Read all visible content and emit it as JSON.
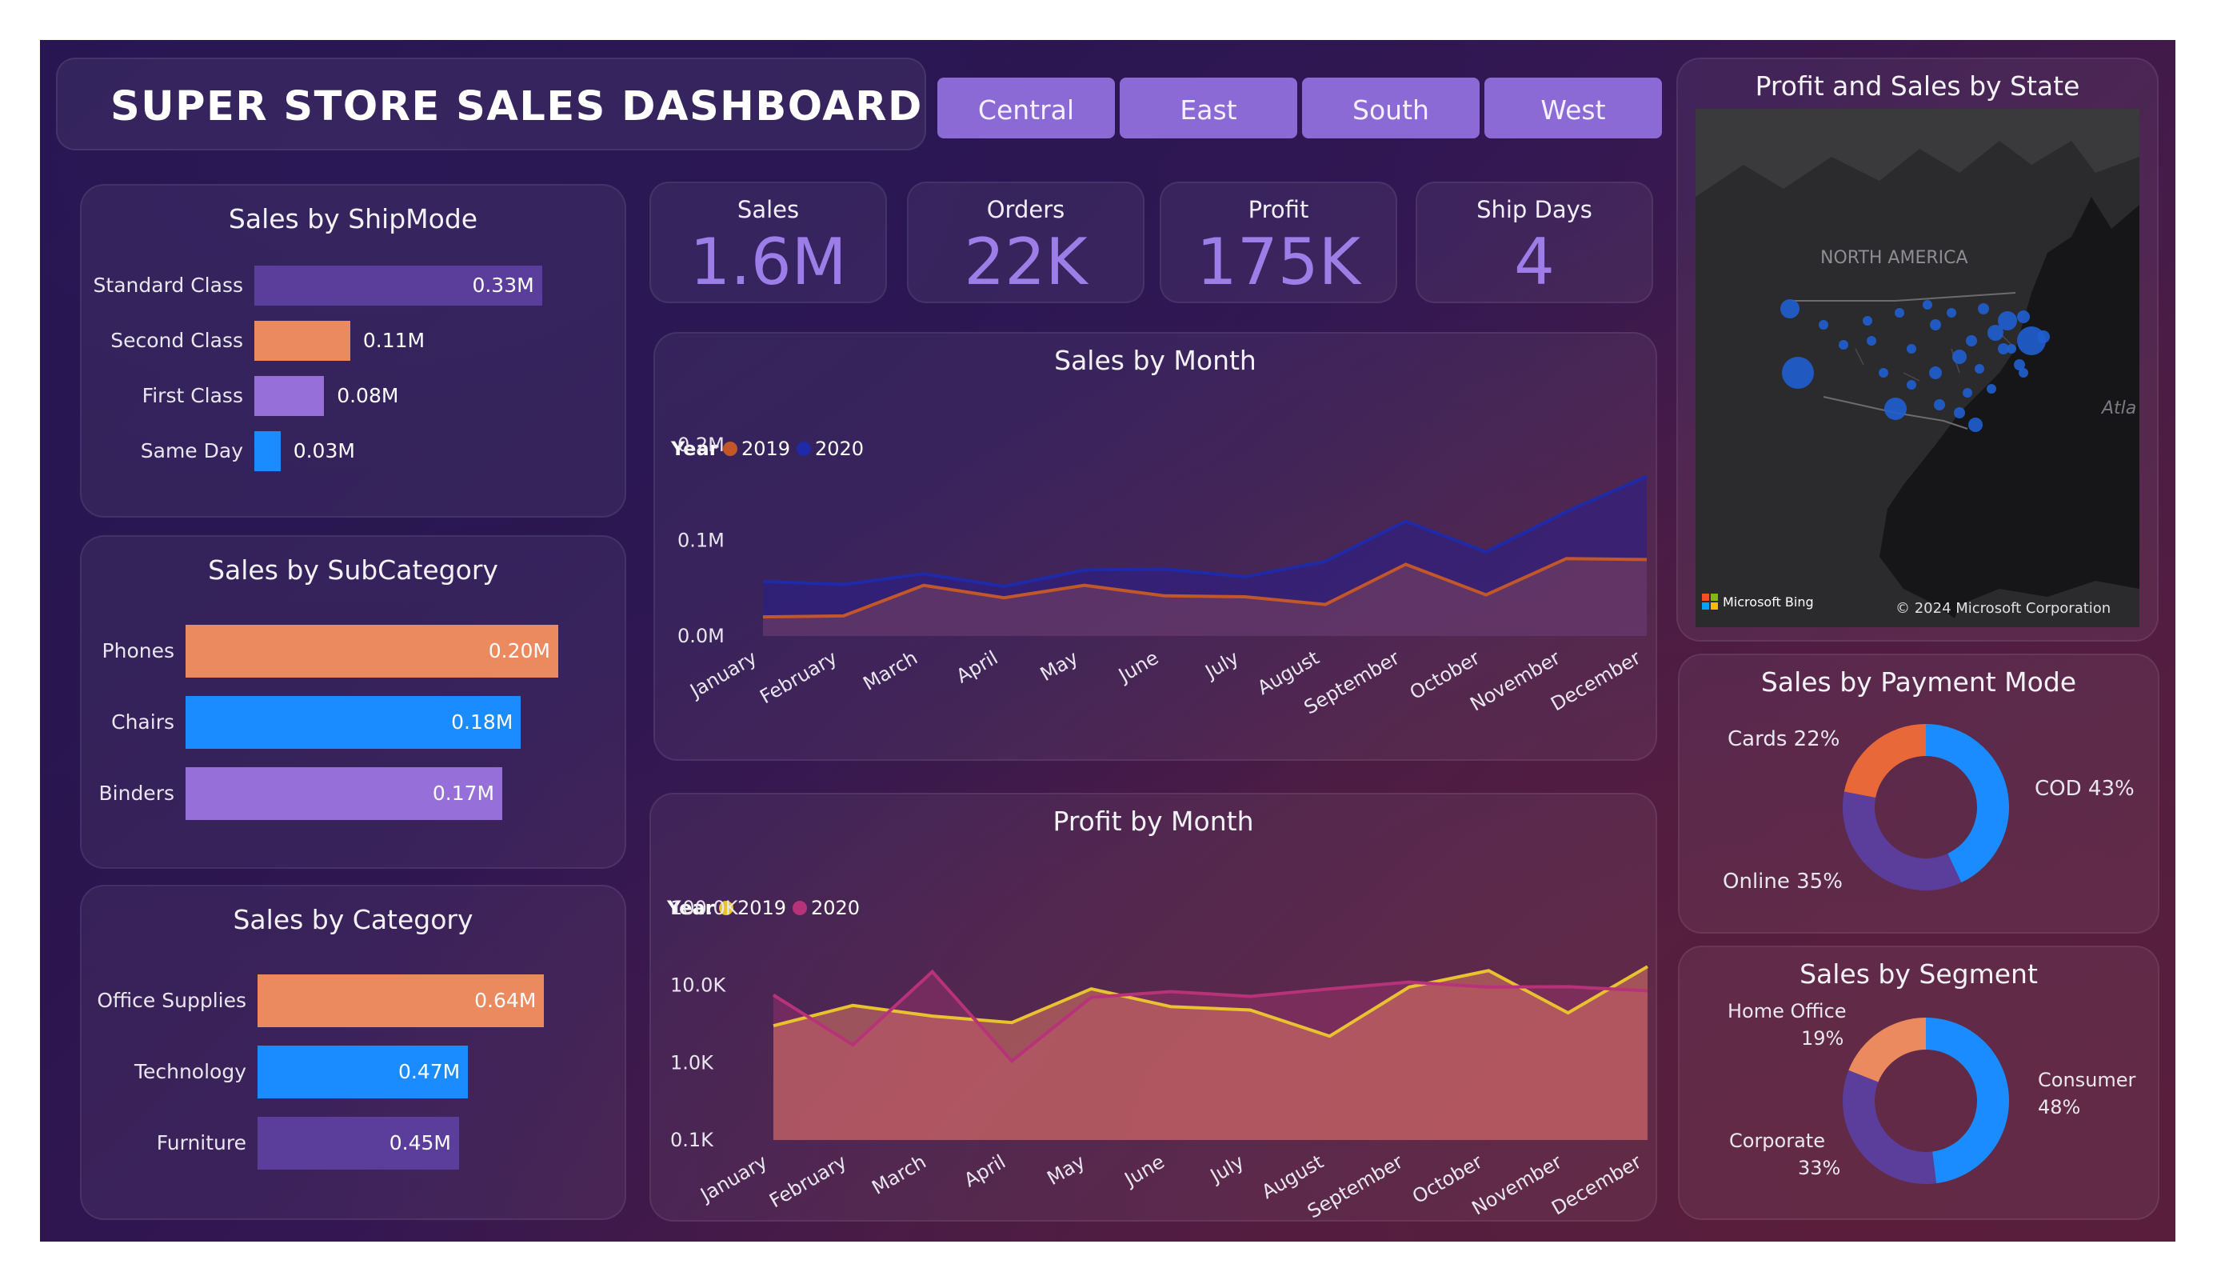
{
  "header": {
    "title": "SUPER STORE SALES DASHBOARD"
  },
  "regions": [
    "Central",
    "East",
    "South",
    "West"
  ],
  "kpis": [
    {
      "label": "Sales",
      "value": "1.6M"
    },
    {
      "label": "Orders",
      "value": "22K"
    },
    {
      "label": "Profit",
      "value": "175K"
    },
    {
      "label": "Ship Days",
      "value": "4"
    }
  ],
  "ship_mode": {
    "title": "Sales by ShipMode",
    "chart_data": {
      "type": "bar",
      "categories": [
        "Standard Class",
        "Second Class",
        "First Class",
        "Same Day"
      ],
      "values": [
        0.33,
        0.11,
        0.08,
        0.03
      ],
      "labels": [
        "0.33M",
        "0.11M",
        "0.08M",
        "0.03M"
      ],
      "colors": [
        "#5b3d9c",
        "#eb8a5e",
        "#9670d8",
        "#1a8cff"
      ]
    }
  },
  "sub_category": {
    "title": "Sales by SubCategory",
    "chart_data": {
      "type": "bar",
      "categories": [
        "Phones",
        "Chairs",
        "Binders"
      ],
      "values": [
        0.2,
        0.18,
        0.17
      ],
      "labels": [
        "0.20M",
        "0.18M",
        "0.17M"
      ],
      "colors": [
        "#eb8a5e",
        "#1a8cff",
        "#9670d8"
      ]
    }
  },
  "category": {
    "title": "Sales by Category",
    "chart_data": {
      "type": "bar",
      "categories": [
        "Office Supplies",
        "Technology",
        "Furniture"
      ],
      "values": [
        0.64,
        0.47,
        0.45
      ],
      "labels": [
        "0.64M",
        "0.47M",
        "0.45M"
      ],
      "colors": [
        "#eb8a5e",
        "#1a8cff",
        "#5b3d9c"
      ]
    }
  },
  "sales_month": {
    "title": "Sales by Month",
    "legend_label": "Year",
    "chart_data": {
      "type": "area",
      "x": [
        "January",
        "February",
        "March",
        "April",
        "May",
        "June",
        "July",
        "August",
        "September",
        "October",
        "November",
        "December"
      ],
      "ylim": [
        0,
        0.2
      ],
      "yticks": [
        "0.0M",
        "0.1M",
        "0.2M"
      ],
      "series": [
        {
          "name": "2019",
          "color": "#c2572a",
          "values": [
            0.02,
            0.021,
            0.053,
            0.04,
            0.053,
            0.042,
            0.041,
            0.033,
            0.075,
            0.043,
            0.081,
            0.08
          ]
        },
        {
          "name": "2020",
          "color": "#1f2aa8",
          "values": [
            0.057,
            0.054,
            0.065,
            0.052,
            0.069,
            0.07,
            0.062,
            0.078,
            0.12,
            0.088,
            0.13,
            0.167
          ]
        }
      ]
    }
  },
  "profit_month": {
    "title": "Profit by Month",
    "legend_label": "Year",
    "chart_data": {
      "type": "area",
      "scale": "log",
      "x": [
        "January",
        "February",
        "March",
        "April",
        "May",
        "June",
        "July",
        "August",
        "September",
        "October",
        "November",
        "December"
      ],
      "ylim": [
        100,
        100000
      ],
      "yticks": [
        "0.1K",
        "1.0K",
        "10.0K",
        "100.0K"
      ],
      "series": [
        {
          "name": "2019",
          "color": "#e8c22f",
          "values": [
            3000,
            5500,
            4000,
            3300,
            9000,
            5300,
            4800,
            2200,
            9500,
            15500,
            4400,
            17500
          ]
        },
        {
          "name": "2020",
          "color": "#b8327a",
          "values": [
            7500,
            1700,
            15000,
            1050,
            7000,
            8300,
            7200,
            9000,
            11000,
            9500,
            9600,
            8500
          ]
        }
      ]
    }
  },
  "map": {
    "title": "Profit and Sales by State",
    "region_label": "NORTH AMERICA",
    "ocean_label": "Atla",
    "brand": "Microsoft Bing",
    "copyright": "© 2024 Microsoft Corporation"
  },
  "payment": {
    "title": "Sales by Payment Mode",
    "chart_data": {
      "type": "pie",
      "categories": [
        "COD",
        "Online",
        "Cards"
      ],
      "values": [
        43,
        35,
        22
      ],
      "colors": [
        "#1a8cff",
        "#5b3d9c",
        "#e8683a"
      ]
    },
    "labels": {
      "cards": "Cards 22%",
      "cod": "COD 43%",
      "online": "Online 35%"
    }
  },
  "segment": {
    "title": "Sales by Segment",
    "chart_data": {
      "type": "pie",
      "categories": [
        "Consumer",
        "Corporate",
        "Home Office"
      ],
      "values": [
        48,
        33,
        19
      ],
      "colors": [
        "#1a8cff",
        "#5b3d9c",
        "#eb8a5e"
      ]
    },
    "labels": {
      "home_office_name": "Home Office",
      "home_office_pct": "19%",
      "consumer_name": "Consumer",
      "consumer_pct": "48%",
      "corporate_name": "Corporate",
      "corporate_pct": "33%"
    }
  }
}
